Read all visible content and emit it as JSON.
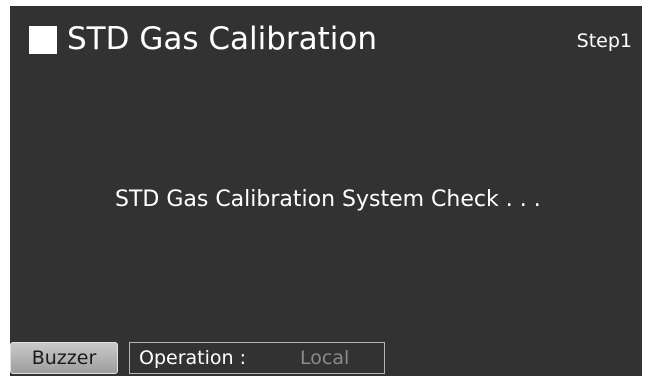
{
  "header": {
    "title": "STD Gas Calibration",
    "step": "Step1",
    "title_marker": "square-icon"
  },
  "main": {
    "message": "STD Gas Calibration System Check . . ."
  },
  "footer": {
    "buzzer_label": "Buzzer",
    "operation_label": "Operation :",
    "operation_value": "Local"
  },
  "colors": {
    "panel_background": "#323232",
    "text": "#ffffff",
    "operation_value": "#8a8a8a",
    "buzzer_button": "#b4b4b4"
  }
}
